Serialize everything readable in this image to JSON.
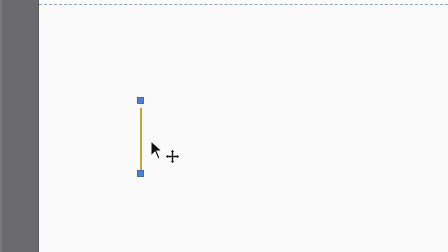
{
  "app": {
    "view": "drawing canvas"
  },
  "canvas": {
    "selected_shape": "line",
    "line_color": "#c9a536",
    "handle_color": "#4b7fd8",
    "guide_style": "dashed"
  },
  "cursor": {
    "pointer_icon": "arrow-cursor-icon",
    "move_icon": "move-cursor-icon"
  }
}
